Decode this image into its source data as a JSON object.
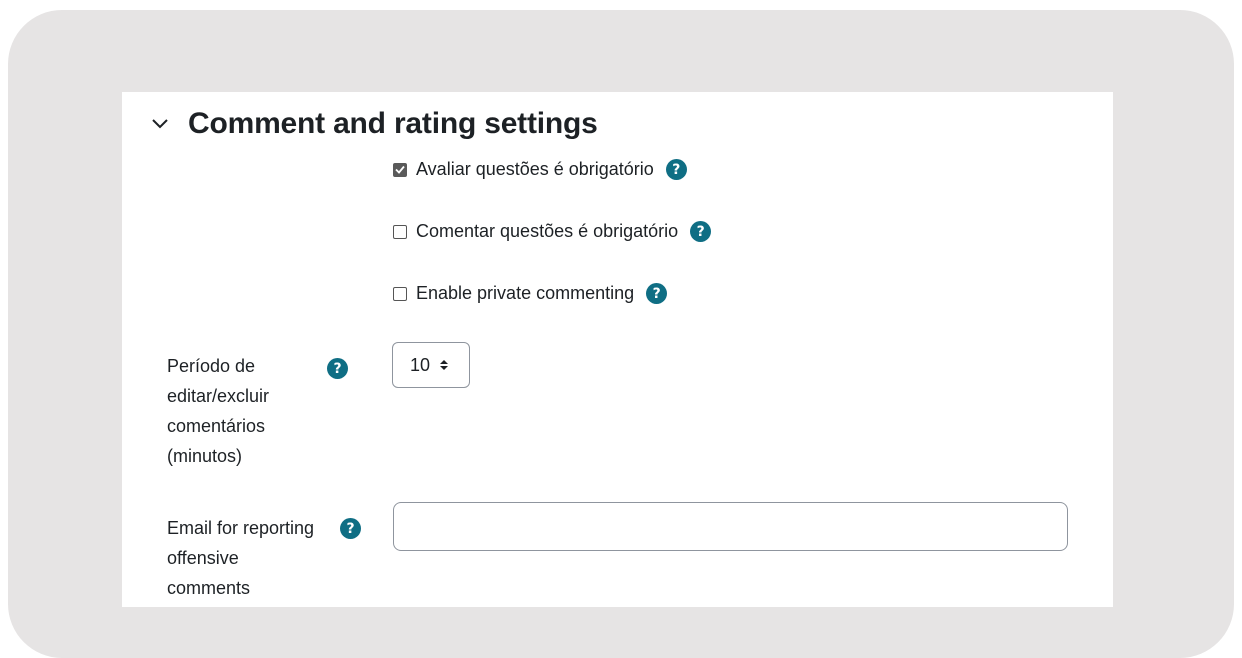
{
  "section": {
    "title": "Comment and rating settings"
  },
  "checkboxes": [
    {
      "label": "Avaliar questões é obrigatório",
      "checked": true
    },
    {
      "label": "Comentar questões é obrigatório",
      "checked": false
    },
    {
      "label": "Enable private commenting",
      "checked": false
    }
  ],
  "edit_period": {
    "label_lines": [
      "Período de",
      "editar/excluir",
      "comentários",
      "(minutos)"
    ],
    "value": "10"
  },
  "offensive_email": {
    "label_lines": [
      "Email for reporting",
      "offensive",
      "comments"
    ],
    "value": "",
    "placeholder": ""
  },
  "help_icon_glyph": "?",
  "colors": {
    "help_icon": "#0f6e84",
    "background_frame": "#e6e4e4",
    "text": "#1d2125"
  }
}
